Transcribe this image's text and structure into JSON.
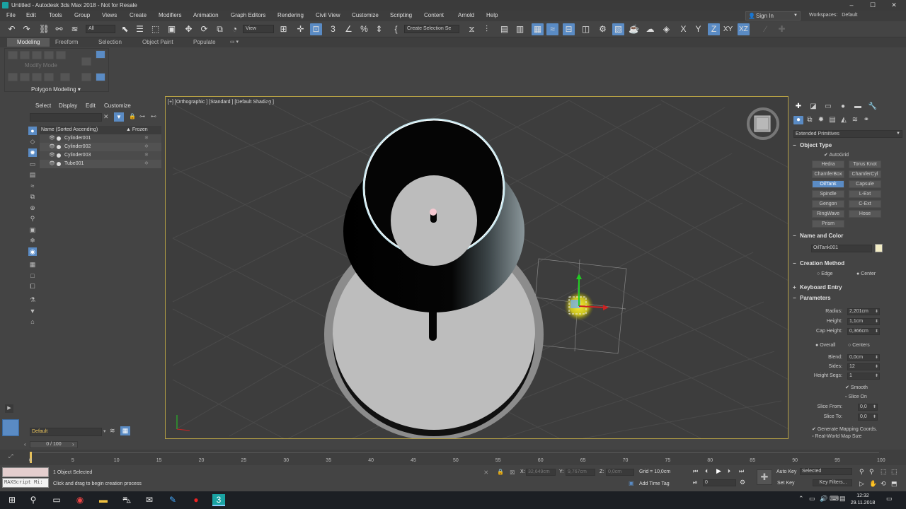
{
  "app": {
    "title": "Untitled - Autodesk 3ds Max 2018 - Not for Resale",
    "minimize": "–",
    "maximize": "☐",
    "close": "✕"
  },
  "menu": [
    "File",
    "Edit",
    "Tools",
    "Group",
    "Views",
    "Create",
    "Modifiers",
    "Animation",
    "Graph Editors",
    "Rendering",
    "Civil View",
    "Customize",
    "Scripting",
    "Content",
    "Arnold",
    "Help"
  ],
  "account": {
    "sign_in": "Sign In",
    "workspaces_label": "Workspaces:",
    "workspace_value": "Default"
  },
  "toolbar": {
    "filter_value": "All",
    "refcoord_value": "View",
    "selection_set_placeholder": "Create Selection Se",
    "axis_x": "X",
    "axis_y": "Y",
    "axis_z": "Z",
    "axis_xy": "XY",
    "axis_xz": "XZ"
  },
  "ribbon": {
    "tabs": [
      "Modeling",
      "Freeform",
      "Selection",
      "Object Paint",
      "Populate"
    ],
    "selected_tab": "Modeling",
    "modify_mode": "Modify Mode",
    "panel_label": "Polygon Modeling ▾"
  },
  "scene_explorer": {
    "menu": [
      "Select",
      "Display",
      "Edit",
      "Customize"
    ],
    "column_name": "Name (Sorted Ascending)",
    "column_frozen": "▲ Frozen",
    "items": [
      "Cylinder001",
      "Cylinder002",
      "Cylinder003",
      "Tube001"
    ],
    "layer": "Default"
  },
  "viewport": {
    "label": "[+] [Orthographic ] [Standard ] [Default Shading ]"
  },
  "command_panel": {
    "category": "Extended Primitives",
    "object_type": {
      "title": "Object Type",
      "autogrid": "AutoGrid",
      "buttons": [
        "Hedra",
        "Torus Knot",
        "ChamferBox",
        "ChamferCyl",
        "OilTank",
        "Capsule",
        "Spindle",
        "L-Ext",
        "Gengon",
        "C-Ext",
        "RingWave",
        "Hose",
        "Prism"
      ],
      "selected": "OilTank"
    },
    "name_color": {
      "title": "Name and Color",
      "name": "OilTank001",
      "color": "#f3edc5"
    },
    "creation_method": {
      "title": "Creation Method",
      "options": [
        "Edge",
        "Center"
      ],
      "selected": "Center"
    },
    "keyboard_entry": {
      "title": "Keyboard Entry"
    },
    "parameters": {
      "title": "Parameters",
      "radius_label": "Radius:",
      "radius": "2,201cm",
      "height_label": "Height:",
      "height": "1,1cm",
      "cap_height_label": "Cap Height:",
      "cap_height": "0,366cm",
      "overall": "Overall",
      "centers": "Centers",
      "blend_label": "Blend:",
      "blend": "0,0cm",
      "sides_label": "Sides:",
      "sides": "12",
      "height_segs_label": "Height Segs:",
      "height_segs": "1",
      "smooth": "Smooth",
      "slice_on": "Slice On",
      "slice_from_label": "Slice From:",
      "slice_from": "0,0",
      "slice_to_label": "Slice To:",
      "slice_to": "0,0",
      "gen_mapping": "Generate Mapping Coords.",
      "real_world": "Real-World Map Size"
    }
  },
  "timeline": {
    "frame": "0 / 100",
    "ticks": [
      "0",
      "5",
      "10",
      "15",
      "20",
      "25",
      "30",
      "35",
      "40",
      "45",
      "50",
      "55",
      "60",
      "65",
      "70",
      "75",
      "80",
      "85",
      "90",
      "95",
      "100"
    ]
  },
  "status": {
    "maxscript": "MAXScript Mi:",
    "selected": "1 Object Selected",
    "prompt": "Click and drag to begin creation process",
    "x_label": "X:",
    "x": "32,649cm",
    "y_label": "Y:",
    "y": "9,767cm",
    "z_label": "Z:",
    "z": "0,0cm",
    "grid": "Grid = 10,0cm",
    "add_time_tag": "Add Time Tag",
    "auto_key": "Auto Key",
    "set_key": "Set Key",
    "selected_dd": "Selected",
    "key_filters": "Key Filters...",
    "frame_value": "0"
  },
  "taskbar": {
    "time": "12:32",
    "date": "29.11.2018"
  }
}
